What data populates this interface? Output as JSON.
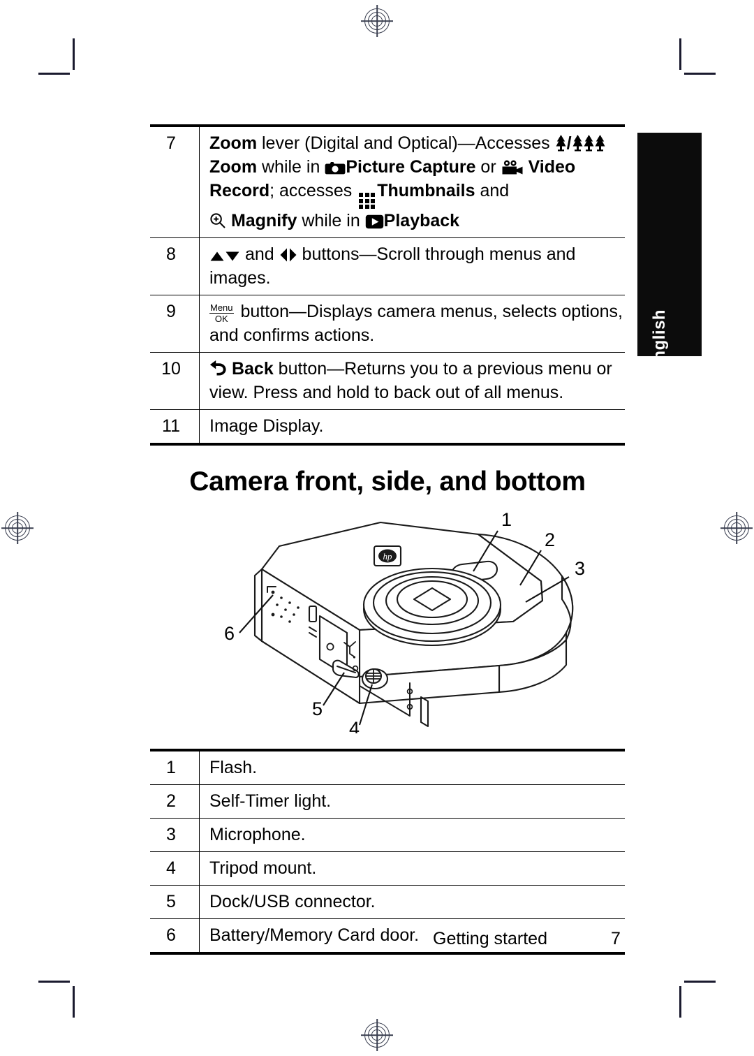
{
  "document": {
    "language_tab": "English",
    "heading": "Camera front, side, and bottom",
    "footer": {
      "section": "Getting started",
      "page_number": "7"
    }
  },
  "controls_table": {
    "rows": [
      {
        "number": "7",
        "segments": [
          {
            "text": "Zoom",
            "bold": true
          },
          {
            "text": " lever (Digital and Optical)—Accesses ",
            "bold": false
          },
          {
            "icon": "zoom-wide-tree-icon"
          },
          {
            "text": "/",
            "bold": true
          },
          {
            "icon": "zoom-tele-trees-icon"
          },
          {
            "text": " ",
            "bold": false
          },
          {
            "text": "Zoom",
            "bold": true
          },
          {
            "text": " while in ",
            "bold": false
          },
          {
            "icon": "picture-capture-camera-icon"
          },
          {
            "text": " Picture Capture",
            "bold": true
          },
          {
            "text": " or ",
            "bold": false
          },
          {
            "icon": "video-record-camcorder-icon"
          },
          {
            "text": " Video Record",
            "bold": true
          },
          {
            "text": "; accesses ",
            "bold": false
          },
          {
            "icon": "thumbnails-grid-icon"
          },
          {
            "text": "Thumbnails",
            "bold": true
          },
          {
            "text": " and ",
            "bold": false
          },
          {
            "icon": "magnify-icon"
          },
          {
            "text": " Magnify",
            "bold": true
          },
          {
            "text": " while in ",
            "bold": false
          },
          {
            "icon": "playback-icon"
          },
          {
            "text": " Playback",
            "bold": true
          }
        ],
        "plain": "Zoom lever (Digital and Optical)—Accesses /  Zoom while in  Picture Capture or  Video Record; accesses  Thumbnails and  Magnify while in  Playback"
      },
      {
        "number": "8",
        "plain": "▲▼ and ◀▶ buttons—Scroll through menus and images."
      },
      {
        "number": "9",
        "plain": "Menu/OK button—Displays camera menus, selects options, and confirms actions."
      },
      {
        "number": "10",
        "plain": "↩ Back button—Returns you to a previous menu or view. Press and hold to back out of all menus."
      },
      {
        "number": "11",
        "plain": "Image Display."
      }
    ],
    "row8": {
      "text_after_arrows": " buttons—Scroll through menus and images.",
      "and_word": " and "
    },
    "row9": {
      "menu_label": "Menu",
      "ok_label": "OK",
      "text": " button—Displays camera menus, selects options, and confirms actions."
    },
    "row10": {
      "back_label": "Back",
      "text": " button—Returns you to a previous menu or view. Press and hold to back out of all menus."
    },
    "row11": {
      "text": "Image Display."
    },
    "row7": {
      "zoom_word_1": "Zoom",
      "part_1": " lever (Digital and Optical)—Accesses ",
      "slash": "/",
      "zoom_word_2": "Zoom",
      "part_2": " while in ",
      "picture_capture": "Picture Capture",
      "or_word": " or ",
      "video": "Video",
      "record": "Record",
      "part_3": "; accesses ",
      "thumbnails": "Thumbnails",
      "and_word": " and ",
      "magnify": "Magnify",
      "part_4": " while in ",
      "playback": "Playback"
    }
  },
  "parts_table": {
    "rows": [
      {
        "number": "1",
        "label": "Flash."
      },
      {
        "number": "2",
        "label": "Self-Timer light."
      },
      {
        "number": "3",
        "label": "Microphone."
      },
      {
        "number": "4",
        "label": "Tripod mount."
      },
      {
        "number": "5",
        "label": "Dock/USB connector."
      },
      {
        "number": "6",
        "label": "Battery/Memory Card door."
      }
    ]
  },
  "figure": {
    "alt": "HP digital camera shown from front, side, and bottom with numbered callouts",
    "brand_mark": "hp",
    "callouts": [
      {
        "number": "1",
        "target": "flash"
      },
      {
        "number": "2",
        "target": "self-timer-light"
      },
      {
        "number": "3",
        "target": "microphone"
      },
      {
        "number": "4",
        "target": "tripod-mount"
      },
      {
        "number": "5",
        "target": "dock-usb-connector"
      },
      {
        "number": "6",
        "target": "battery-memory-card-door"
      }
    ]
  },
  "colors": {
    "ink": "#000000",
    "tab_background": "#0c0c0c",
    "tab_text": "#ffffff",
    "registration": "#3a3f50"
  }
}
